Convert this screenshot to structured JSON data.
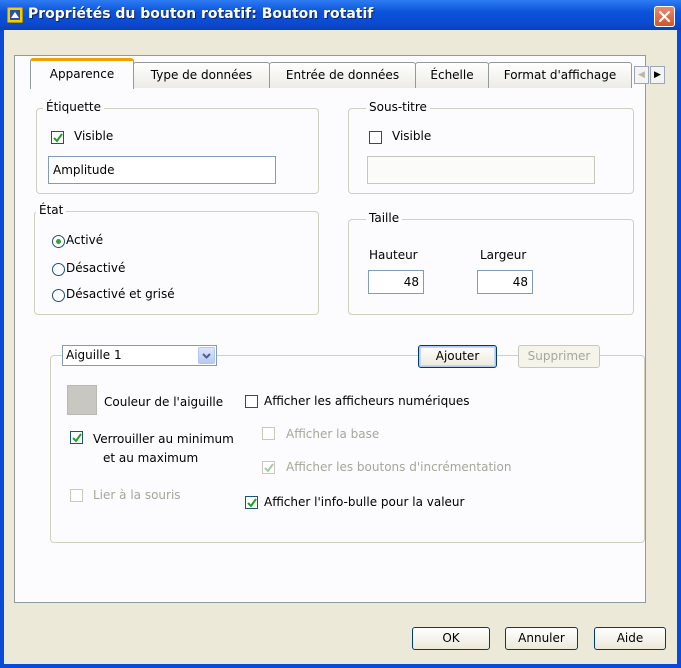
{
  "window": {
    "title": "Propriétés du bouton rotatif: Bouton rotatif"
  },
  "tabs": [
    {
      "label": "Apparence",
      "active": true
    },
    {
      "label": "Type de données",
      "active": false
    },
    {
      "label": "Entrée de données",
      "active": false
    },
    {
      "label": "Échelle",
      "active": false
    },
    {
      "label": "Format d'affichage",
      "active": false
    }
  ],
  "etiquette": {
    "legend": "Étiquette",
    "visible_label": "Visible",
    "visible_checked": true,
    "value": "Amplitude"
  },
  "soustitre": {
    "legend": "Sous-titre",
    "visible_label": "Visible",
    "visible_checked": false,
    "value": ""
  },
  "etat": {
    "legend": "État",
    "options": [
      {
        "label": "Activé",
        "selected": true
      },
      {
        "label": "Désactivé",
        "selected": false
      },
      {
        "label": "Désactivé et grisé",
        "selected": false
      }
    ]
  },
  "taille": {
    "legend": "Taille",
    "hauteur_label": "Hauteur",
    "hauteur_value": "48",
    "largeur_label": "Largeur",
    "largeur_value": "48"
  },
  "aiguille": {
    "selected": "Aiguille 1",
    "add_label": "Ajouter",
    "delete_label": "Supprimer",
    "color_label": "Couleur de l'aiguille",
    "lock_label_line1": "Verrouiller au minimum",
    "lock_label_line2": "et au maximum",
    "lock_checked": true,
    "mouse_label": "Lier à la souris",
    "show_digital_label": "Afficher les afficheurs numériques",
    "show_base_label": "Afficher la base",
    "show_inc_label": "Afficher les boutons d'incrémentation",
    "show_tooltip_label": "Afficher l'info-bulle pour la valeur"
  },
  "buttons": {
    "ok": "OK",
    "cancel": "Annuler",
    "help": "Aide"
  }
}
